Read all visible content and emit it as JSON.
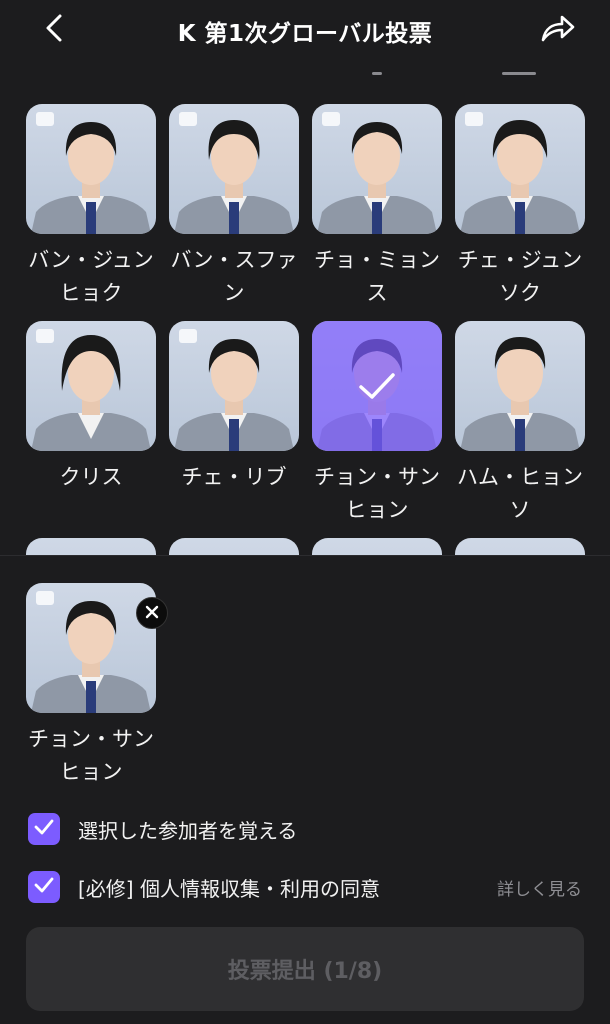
{
  "header": {
    "title": "K 第1次グローバル投票",
    "back_icon": "chevron-left-icon",
    "share_icon": "share-arrow-icon"
  },
  "grid": {
    "rows": [
      [
        {
          "name": "バン・ジュンヒョク",
          "selected": false
        },
        {
          "name": "バン・スファン",
          "selected": false
        },
        {
          "name": "チョ・ミョンス",
          "selected": false
        },
        {
          "name": "チェ・ジュンソク",
          "selected": false
        }
      ],
      [
        {
          "name": "クリス",
          "selected": false
        },
        {
          "name": "チェ・リブ",
          "selected": false
        },
        {
          "name": "チョン・サンヒョン",
          "selected": true
        },
        {
          "name": "ハム・ヒョンソ",
          "selected": false
        }
      ]
    ]
  },
  "selection": {
    "items": [
      {
        "name": "チョン・サンヒョン",
        "remove_icon": "close-icon"
      }
    ]
  },
  "checkboxes": {
    "remember": {
      "label": "選択した参加者を覚える",
      "checked": true
    },
    "consent": {
      "label": "[必修] 個人情報収集・利用の同意",
      "checked": true,
      "details_link": "詳しく見る"
    }
  },
  "submit": {
    "label": "投票提出 (1/8)",
    "enabled": false
  },
  "colors": {
    "accent": "#7c5cff",
    "background": "#1c1c1e",
    "button_disabled": "#2f2f31"
  }
}
